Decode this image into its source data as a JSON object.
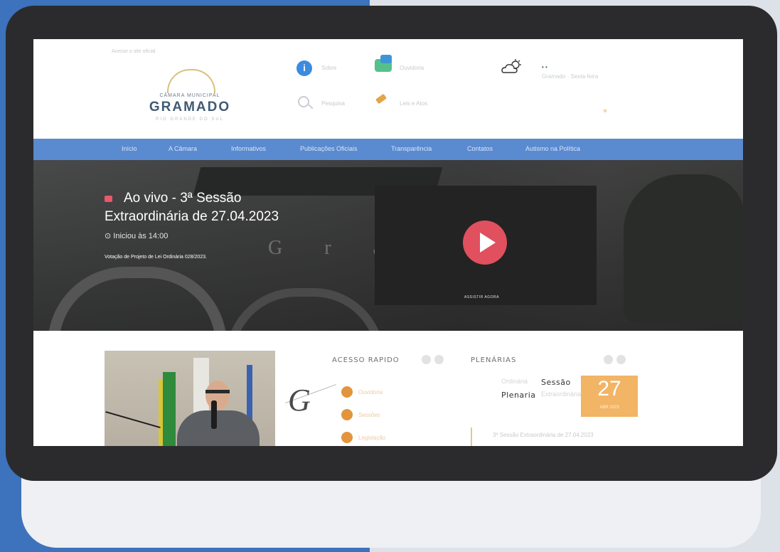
{
  "header": {
    "top_link": "Acesse o site oficial",
    "logo_small": "CÂMARA MUNICIPAL",
    "logo_main": "GRAMADO",
    "logo_sub": "RIO GRANDE DO SUL",
    "quick_labels": [
      "Sobre",
      "Ouvidoria",
      "Pesquisa",
      "Leis e Atos"
    ],
    "weather_temp": "•     •",
    "weather_city": "Gramado · Sexta-feira"
  },
  "nav": {
    "items": [
      "Início",
      "A Câmara",
      "Informativos",
      "Publicações Oficiais",
      "Transparência",
      "Contatos",
      "Autismo na Política"
    ]
  },
  "hero": {
    "live_title_line1": "Ao vivo - 3ª Sessão",
    "live_title_line2": "Extraordinária de 27.04.2023",
    "started_at": "Iniciou às 14:00",
    "description": "Votação de Projeto de Lei Ordinária 028/2023.",
    "watch_label": "ASSISTIR AGORA",
    "facade_letters": "G r a"
  },
  "content": {
    "quick_access_title": "ACESSO RAPIDO",
    "quick_items": [
      "Ouvidoria",
      "Sessões",
      "Legislação"
    ],
    "plenarias_title": "PLENÁRIAS",
    "plenaria_words": [
      "Ordinária",
      "Sessão",
      "Plenaria",
      "Extraordinária"
    ],
    "date_day": "27",
    "date_month": "ABR 2023",
    "snippet": "3ª Sessão Extraordinária de 27.04.2023"
  },
  "icons": {
    "info": "info-icon",
    "chat": "chat-icon",
    "search": "search-icon",
    "gavel": "gavel-icon",
    "weather": "partly-cloudy-icon",
    "live": "live-camera-icon",
    "clock": "clock-icon",
    "play": "play-icon"
  },
  "colors": {
    "nav": "#5a8ad0",
    "live_red": "#e0505f",
    "accent_orange": "#f2b465"
  }
}
